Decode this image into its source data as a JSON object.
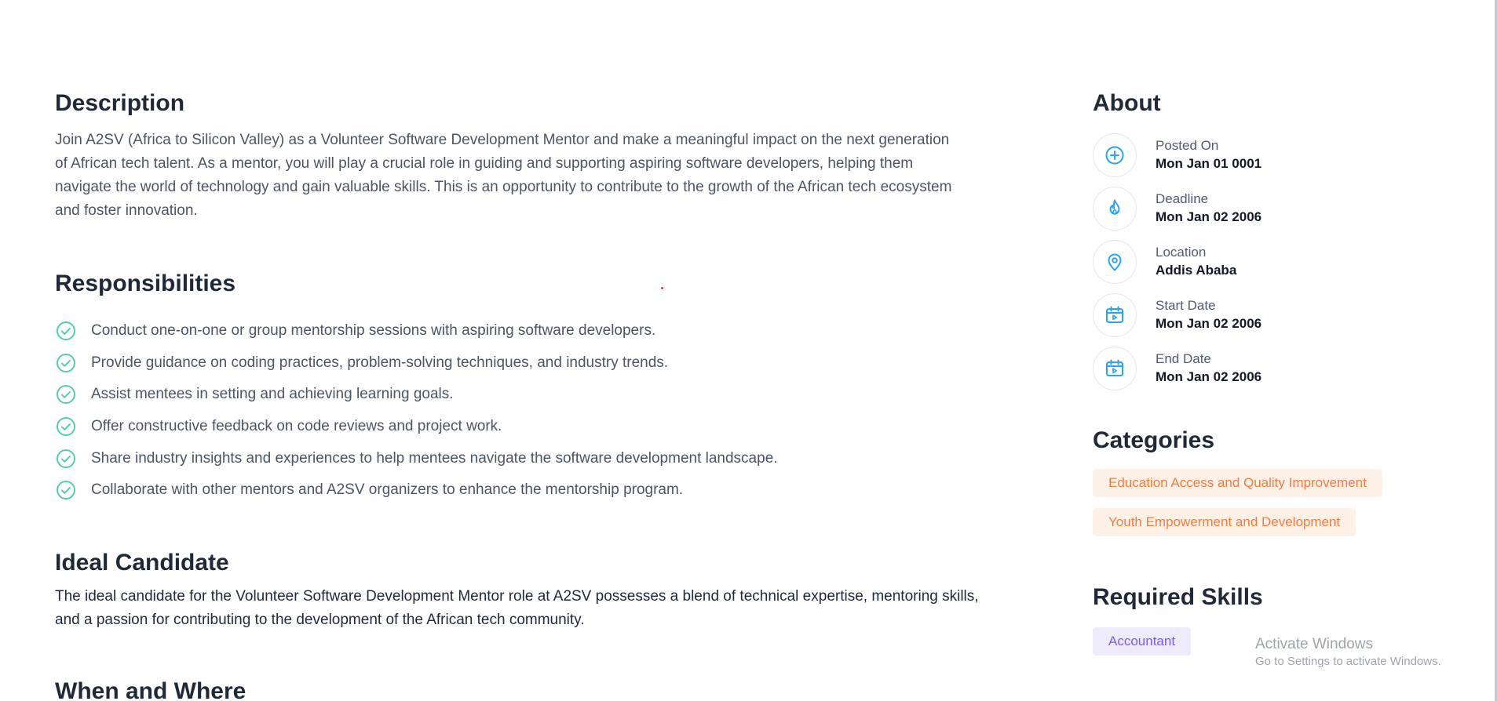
{
  "description": {
    "title": "Description",
    "text": "Join A2SV (Africa to Silicon Valley) as a Volunteer Software Development Mentor and make a meaningful impact on the next generation of African tech talent. As a mentor, you will play a crucial role in guiding and supporting aspiring software developers, helping them navigate the world of technology and gain valuable skills. This is an opportunity to contribute to the growth of the African tech ecosystem and foster innovation."
  },
  "responsibilities": {
    "title": "Responsibilities",
    "items": [
      "Conduct one-on-one or group mentorship sessions with aspiring software developers.",
      "Provide guidance on coding practices, problem-solving techniques, and industry trends.",
      "Assist mentees in setting and achieving learning goals.",
      "Offer constructive feedback on code reviews and project work.",
      "Share industry insights and experiences to help mentees navigate the software development landscape.",
      "Collaborate with other mentors and A2SV organizers to enhance the mentorship program."
    ]
  },
  "ideal_candidate": {
    "title": "Ideal Candidate",
    "text": "The ideal candidate for the Volunteer Software Development Mentor role at A2SV possesses a blend of technical expertise, mentoring skills, and a passion for contributing to the development of the African tech community."
  },
  "when_where": {
    "title": "When and Where"
  },
  "about": {
    "title": "About",
    "items": [
      {
        "icon": "plus-circle-icon",
        "label": "Posted On",
        "value": "Mon Jan 01 0001"
      },
      {
        "icon": "fire-icon",
        "label": "Deadline",
        "value": "Mon Jan 02 2006"
      },
      {
        "icon": "location-pin-icon",
        "label": "Location",
        "value": "Addis Ababa"
      },
      {
        "icon": "calendar-icon",
        "label": "Start Date",
        "value": "Mon Jan 02 2006"
      },
      {
        "icon": "calendar-icon",
        "label": "End Date",
        "value": "Mon Jan 02 2006"
      }
    ]
  },
  "categories": {
    "title": "Categories",
    "items": [
      "Education Access and Quality Improvement",
      "Youth Empowerment and Development"
    ]
  },
  "required_skills": {
    "title": "Required Skills",
    "items": [
      "Accountant"
    ]
  },
  "windows_watermark": {
    "line1": "Activate Windows",
    "line2": "Go to Settings to activate Windows."
  },
  "colors": {
    "accent_blue": "#26A4FF",
    "check_green": "#56CDAD",
    "category_bg": "#FEF2E8",
    "category_text": "#F97B3D",
    "skill_bg": "#EEEBFD",
    "skill_text": "#7C5CE6"
  }
}
